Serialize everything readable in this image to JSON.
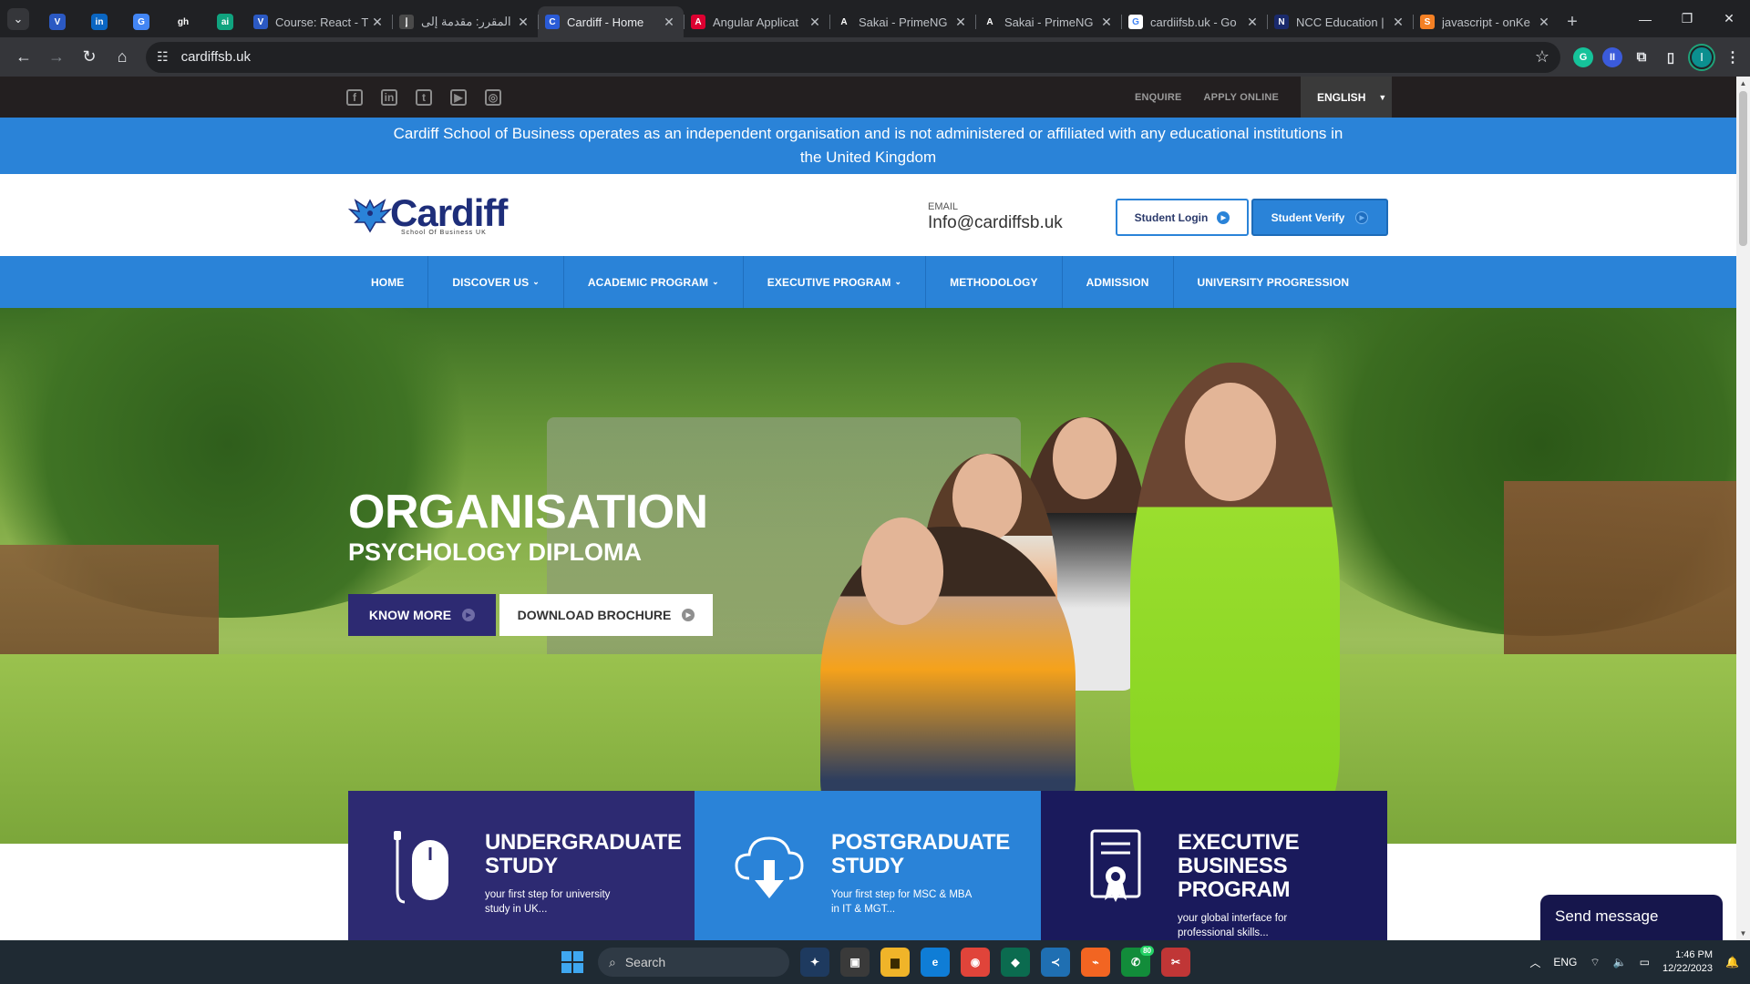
{
  "browser": {
    "tabs": [
      {
        "title": "Course: React - T",
        "fav_color": "#2b59c3",
        "fav": "V"
      },
      {
        "title": "المقرر: مقدمة إلى",
        "fav_color": "#4a4a4a",
        "fav": "إ"
      },
      {
        "title": "Cardiff - Home",
        "fav_color": "#2a5bd7",
        "fav": "C",
        "active": true
      },
      {
        "title": "Angular Applicat",
        "fav_color": "#dd0031",
        "fav": "A"
      },
      {
        "title": "Sakai - PrimeNG",
        "fav_color": "#202124",
        "fav": "A"
      },
      {
        "title": "Sakai - PrimeNG",
        "fav_color": "#202124",
        "fav": "A"
      },
      {
        "title": "cardiifsb.uk - Go",
        "fav_color": "#ffffff",
        "fav": "G"
      },
      {
        "title": "NCC Education |",
        "fav_color": "#1a2a6c",
        "fav": "N"
      },
      {
        "title": "javascript - onKe",
        "fav_color": "#f48024",
        "fav": "S"
      }
    ],
    "pinned": [
      {
        "name": "V",
        "color": "#2b59c3"
      },
      {
        "name": "in",
        "color": "#0a66c2"
      },
      {
        "name": "G",
        "color": "#4285f4"
      },
      {
        "name": "gh",
        "color": "#202124"
      },
      {
        "name": "ai",
        "color": "#10a37f"
      }
    ],
    "url": "cardiffsb.uk",
    "window_controls": {
      "minimize": "—",
      "restore": "❐",
      "close": "✕"
    }
  },
  "site": {
    "social_icons": [
      "f",
      "in",
      "t",
      "▶",
      "◎"
    ],
    "top_links": {
      "enquire": "ENQUIRE",
      "apply": "APPLY ONLINE"
    },
    "language": "ENGLISH",
    "notice": "Cardiff School of Business operates as an independent organisation and is not administered or affiliated with any educational institutions in the United Kingdom",
    "logo": {
      "wordmark": "Cardiff",
      "tagline": "School Of Business UK"
    },
    "email": {
      "label": "EMAIL",
      "value": "Info@cardiffsb.uk"
    },
    "buttons": {
      "login": "Student Login",
      "verify": "Student Verify"
    },
    "nav": [
      {
        "label": "HOME",
        "dropdown": false
      },
      {
        "label": "DISCOVER US",
        "dropdown": true
      },
      {
        "label": "ACADEMIC PROGRAM",
        "dropdown": true
      },
      {
        "label": "EXECUTIVE PROGRAM",
        "dropdown": true
      },
      {
        "label": "METHODOLOGY",
        "dropdown": false
      },
      {
        "label": "ADMISSION",
        "dropdown": false
      },
      {
        "label": "UNIVERSITY PROGRESSION",
        "dropdown": false
      }
    ],
    "hero": {
      "title": "ORGANISATION",
      "subtitle": "PSYCHOLOGY DIPLOMA",
      "know_more": "KNOW MORE",
      "download": "DOWNLOAD BROCHURE",
      "slides": 3,
      "active_slide": 2
    },
    "cards": [
      {
        "title": "UNDERGRADUATE STUDY",
        "text": "your first step for university study in UK...",
        "icon": "mouse-icon"
      },
      {
        "title": "POSTGRADUATE STUDY",
        "text": "Your first step for MSC & MBA in IT & MGT...",
        "icon": "cloud-download-icon"
      },
      {
        "title": "EXECUTIVE BUSINESS PROGRAM",
        "text": "your global interface for professional skills...",
        "icon": "certificate-icon"
      }
    ],
    "chat": "Send message"
  },
  "taskbar": {
    "search": "Search",
    "badge": "80",
    "lang": "ENG",
    "time": "1:46 PM",
    "date": "12/22/2023"
  }
}
